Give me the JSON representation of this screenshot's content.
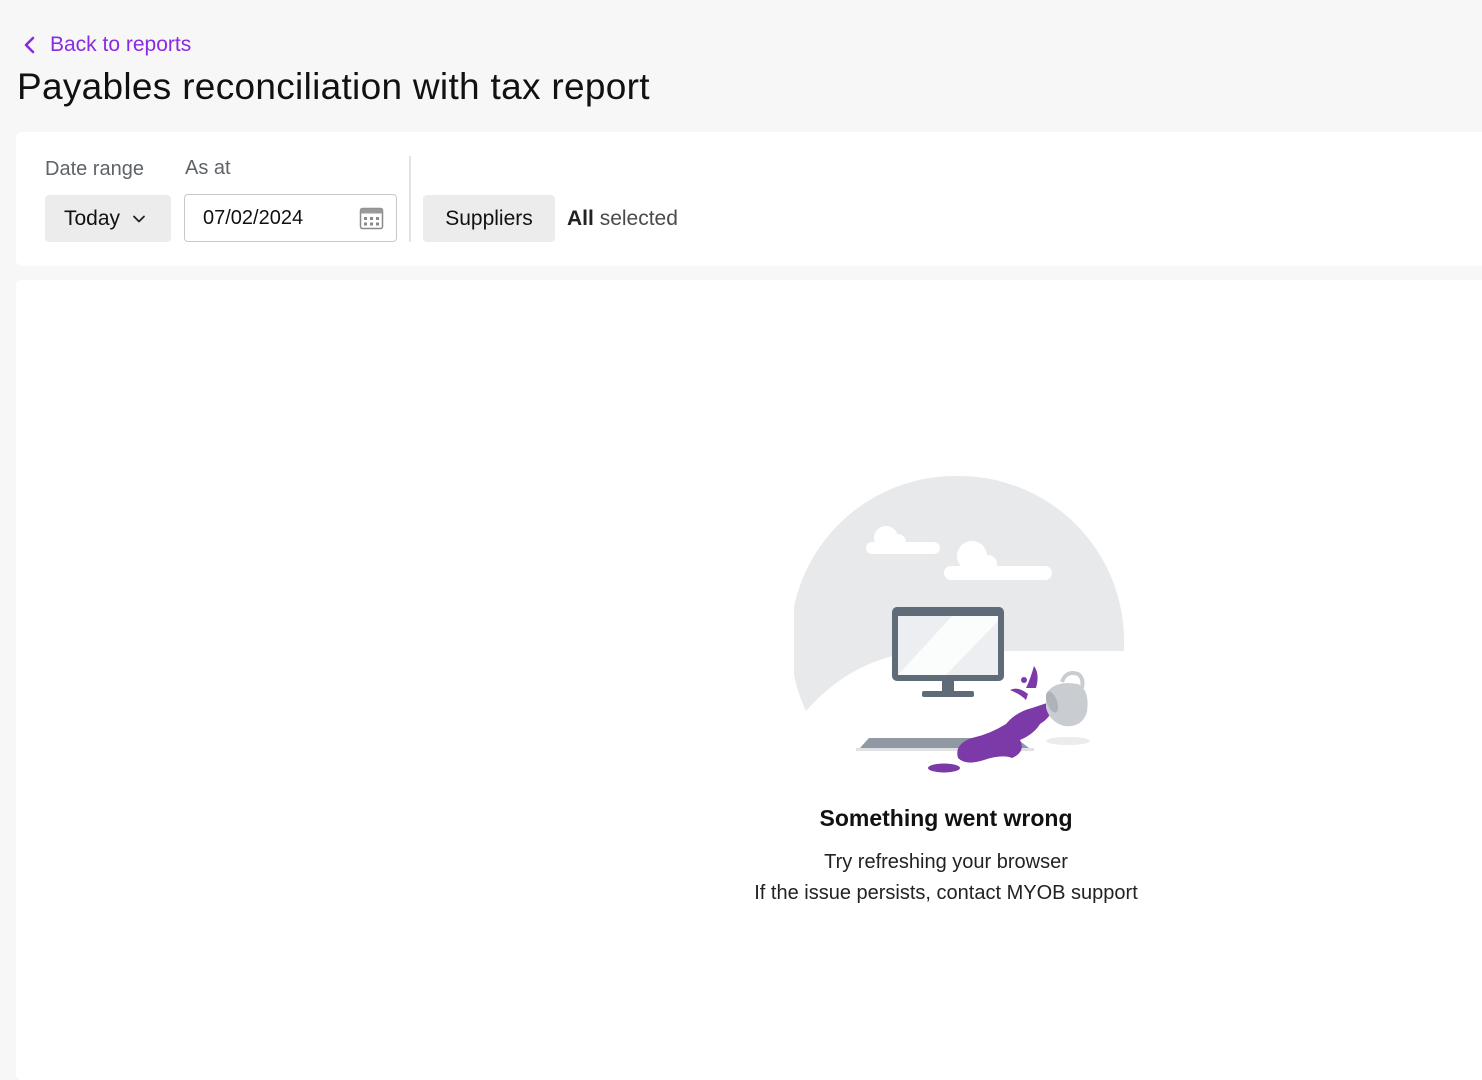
{
  "nav": {
    "back_label": "Back to reports"
  },
  "page": {
    "title": "Payables reconciliation with tax report"
  },
  "filters": {
    "date_range_label": "Date range",
    "date_range_value": "Today",
    "as_at_label": "As at",
    "as_at_value": "07/02/2024",
    "suppliers_label": "Suppliers",
    "selected_bold": "All",
    "selected_suffix": "selected"
  },
  "error": {
    "title": "Something went wrong",
    "line1": "Try refreshing your browser",
    "line2": "If the issue persists, contact MYOB support"
  },
  "colors": {
    "accent": "#8a2be2",
    "spill": "#7b3aa8"
  },
  "icons": {
    "back": "chevron-left-icon",
    "dropdown": "chevron-down-icon",
    "calendar": "calendar-icon",
    "illustration": "spilled-coffee-computer-illustration"
  }
}
